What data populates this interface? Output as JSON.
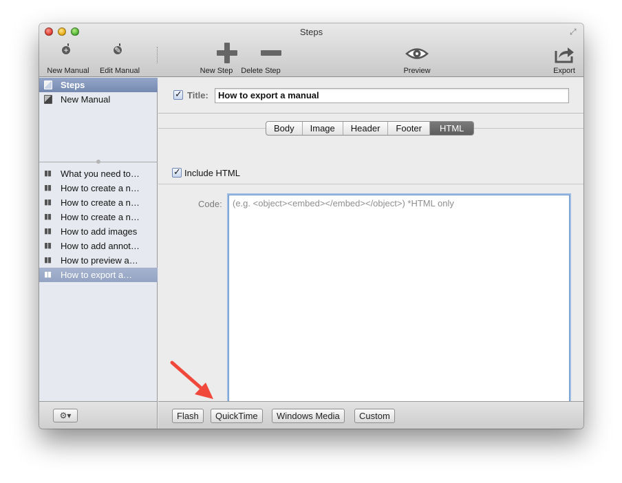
{
  "window": {
    "title": "Steps"
  },
  "toolbar": {
    "new_manual": "New Manual",
    "edit_manual": "Edit Manual",
    "new_step": "New Step",
    "delete_step": "Delete Step",
    "preview": "Preview",
    "export": "Export"
  },
  "sidebar": {
    "manuals": [
      {
        "label": "Steps",
        "selected": true,
        "icon": "manual-doc-icon"
      },
      {
        "label": "New Manual",
        "selected": false,
        "icon": "manual-doc-icon"
      }
    ],
    "steps": [
      {
        "label": "What you need to…",
        "icon": "footprints-icon"
      },
      {
        "label": "How to create a n…",
        "icon": "footprints-icon"
      },
      {
        "label": "How to create a n…",
        "icon": "footprints-icon"
      },
      {
        "label": "How to create a n…",
        "icon": "footprints-icon"
      },
      {
        "label": "How to add images",
        "icon": "footprints-icon"
      },
      {
        "label": "How to add annot…",
        "icon": "footprints-icon"
      },
      {
        "label": "How to preview a…",
        "icon": "footprints-icon"
      },
      {
        "label": "How to export a…",
        "icon": "footprints-icon",
        "selected": true
      }
    ],
    "gear_button": "⚙▾"
  },
  "editor": {
    "title_label": "Title:",
    "title_value": "How to export a manual",
    "title_checked": true,
    "tabs": [
      "Body",
      "Image",
      "Header",
      "Footer",
      "HTML"
    ],
    "active_tab": "HTML",
    "include_html_label": "Include HTML",
    "include_html_checked": true,
    "code_label": "Code:",
    "code_placeholder": "(e.g. <object><embed></embed></object>) *HTML only"
  },
  "bottom_buttons": [
    "Flash",
    "QuickTime",
    "Windows Media",
    "Custom"
  ],
  "colors": {
    "selection": "#7c8fb5",
    "focus_ring": "#9dbce4",
    "annotation_arrow": "#f0483a"
  }
}
